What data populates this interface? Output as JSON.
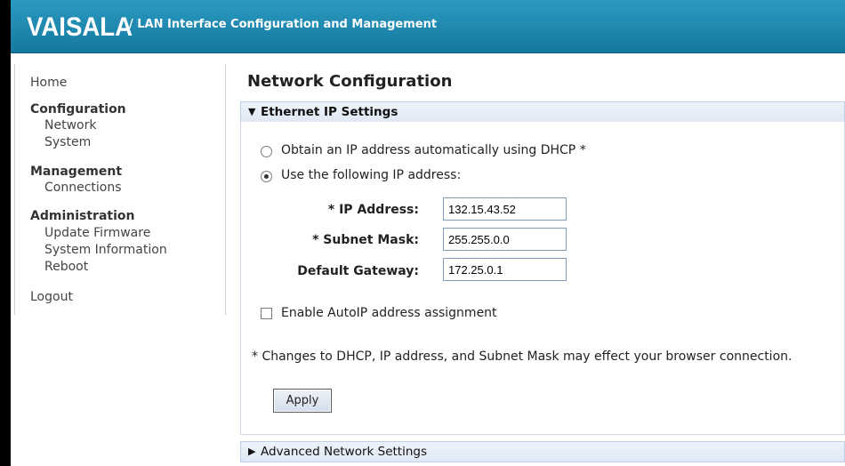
{
  "header": {
    "logo": "VAISALA",
    "title": "/ LAN Interface Configuration and Management"
  },
  "sidebar": {
    "home": "Home",
    "configuration": {
      "heading": "Configuration",
      "items": [
        "Network",
        "System"
      ]
    },
    "management": {
      "heading": "Management",
      "items": [
        "Connections"
      ]
    },
    "administration": {
      "heading": "Administration",
      "items": [
        "Update Firmware",
        "System Information",
        "Reboot"
      ]
    },
    "logout": "Logout"
  },
  "main": {
    "title": "Network Configuration",
    "ethernet_section": {
      "label": "Ethernet IP Settings",
      "expanded": true,
      "dhcp_option": "Obtain an IP address automatically using DHCP *",
      "static_option": "Use the following IP address:",
      "selected": "static",
      "fields": {
        "ip_label": "* IP Address:",
        "ip_value": "132.15.43.52",
        "subnet_label": "* Subnet Mask:",
        "subnet_value": "255.255.0.0",
        "gateway_label": "Default Gateway:",
        "gateway_value": "172.25.0.1"
      },
      "autoip_label": "Enable AutoIP address assignment",
      "autoip_checked": false,
      "note": "* Changes to DHCP, IP address, and Subnet Mask may effect your browser connection.",
      "apply_label": "Apply"
    },
    "advanced_section": {
      "label": "Advanced Network Settings",
      "expanded": false
    }
  },
  "colors": {
    "header_bar": "#1e86ad",
    "section_header": "#dfe8f4"
  }
}
